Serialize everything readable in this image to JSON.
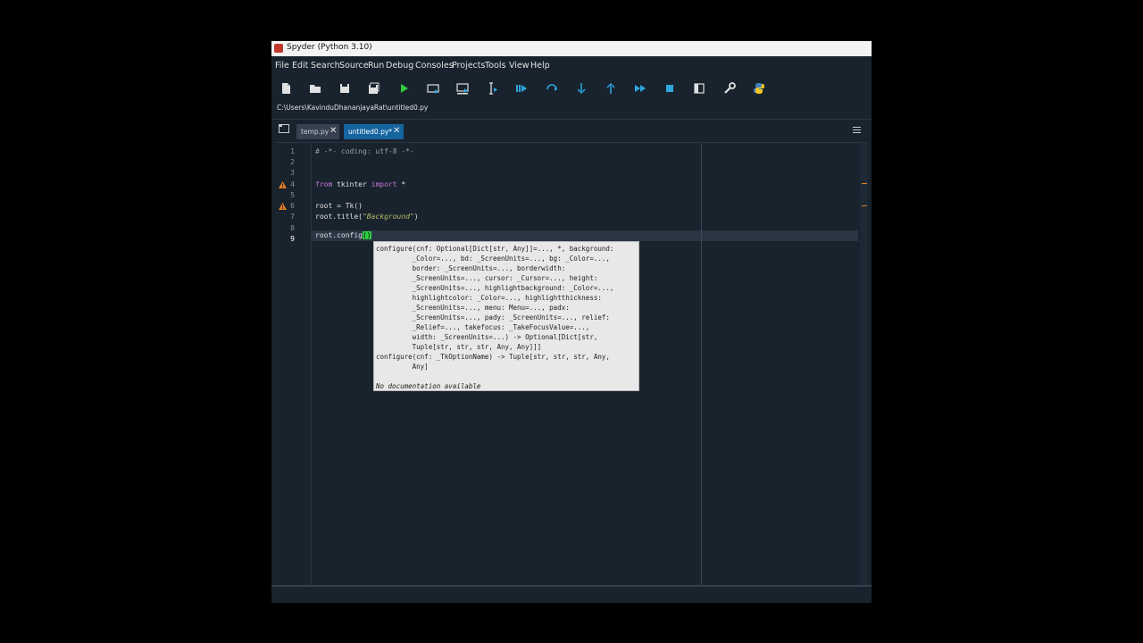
{
  "window": {
    "title": "Spyder (Python 3.10)"
  },
  "menu": [
    "File",
    "Edit",
    "Search",
    "Source",
    "Run",
    "Debug",
    "Consoles",
    "Projects",
    "Tools",
    "View",
    "Help"
  ],
  "toolbar": {
    "icons": [
      "new-file-icon",
      "open-file-icon",
      "save-icon",
      "save-all-icon",
      "run-icon",
      "run-cell-icon",
      "run-cell-advance-icon",
      "run-selection-icon",
      "debug-icon",
      "debug-step-over-icon",
      "debug-step-into-icon",
      "debug-step-return-icon",
      "debug-continue-icon",
      "debug-stop-icon",
      "maximize-pane-icon",
      "preferences-icon",
      "python-path-icon"
    ],
    "colors": {
      "accent": "#2ea7e0",
      "green": "#2ecc40",
      "text": "#dfe1e2"
    }
  },
  "path": "C:\\Users\\KavinduDhananjayaRat\\untitled0.py",
  "tabs": [
    {
      "label": "temp.py",
      "active": false
    },
    {
      "label": "untitled0.py*",
      "active": true
    }
  ],
  "editor": {
    "line_numbers": [
      "1",
      "2",
      "3",
      "4",
      "5",
      "6",
      "7",
      "8",
      "9"
    ],
    "current_line": "9",
    "warning_lines": [
      "4",
      "6"
    ],
    "lines": {
      "l1_comment": "# -*- coding: utf-8 -*-",
      "l4_from": "from",
      "l4_mod": " tkinter ",
      "l4_import": "import",
      "l4_star": " *",
      "l6": "root = Tk()",
      "l7_a": "root.title(",
      "l7_str": "\"Background\"",
      "l7_b": ")",
      "l9_a": "root.config",
      "l9_brk": "()"
    }
  },
  "calltip": {
    "text": "configure(cnf: Optional[Dict[str, Any]]=..., *, background:\n         _Color=..., bd: _ScreenUnits=..., bg: _Color=...,\n         border: _ScreenUnits=..., borderwidth:\n         _ScreenUnits=..., cursor: _Cursor=..., height:\n         _ScreenUnits=..., highlightbackground: _Color=...,\n         highlightcolor: _Color=..., highlightthickness:\n         _ScreenUnits=..., menu: Menu=..., padx:\n         _ScreenUnits=..., pady: _ScreenUnits=..., relief:\n         _Relief=..., takefocus: _TakeFocusValue=...,\n         width: _ScreenUnits=...) -> Optional[Dict[str,\n         Tuple[str, str, str, Any, Any]]]\nconfigure(cnf: _TkOptionName) -> Tuple[str, str, str, Any,\n         Any]",
    "nodoc": "No documentation available"
  }
}
